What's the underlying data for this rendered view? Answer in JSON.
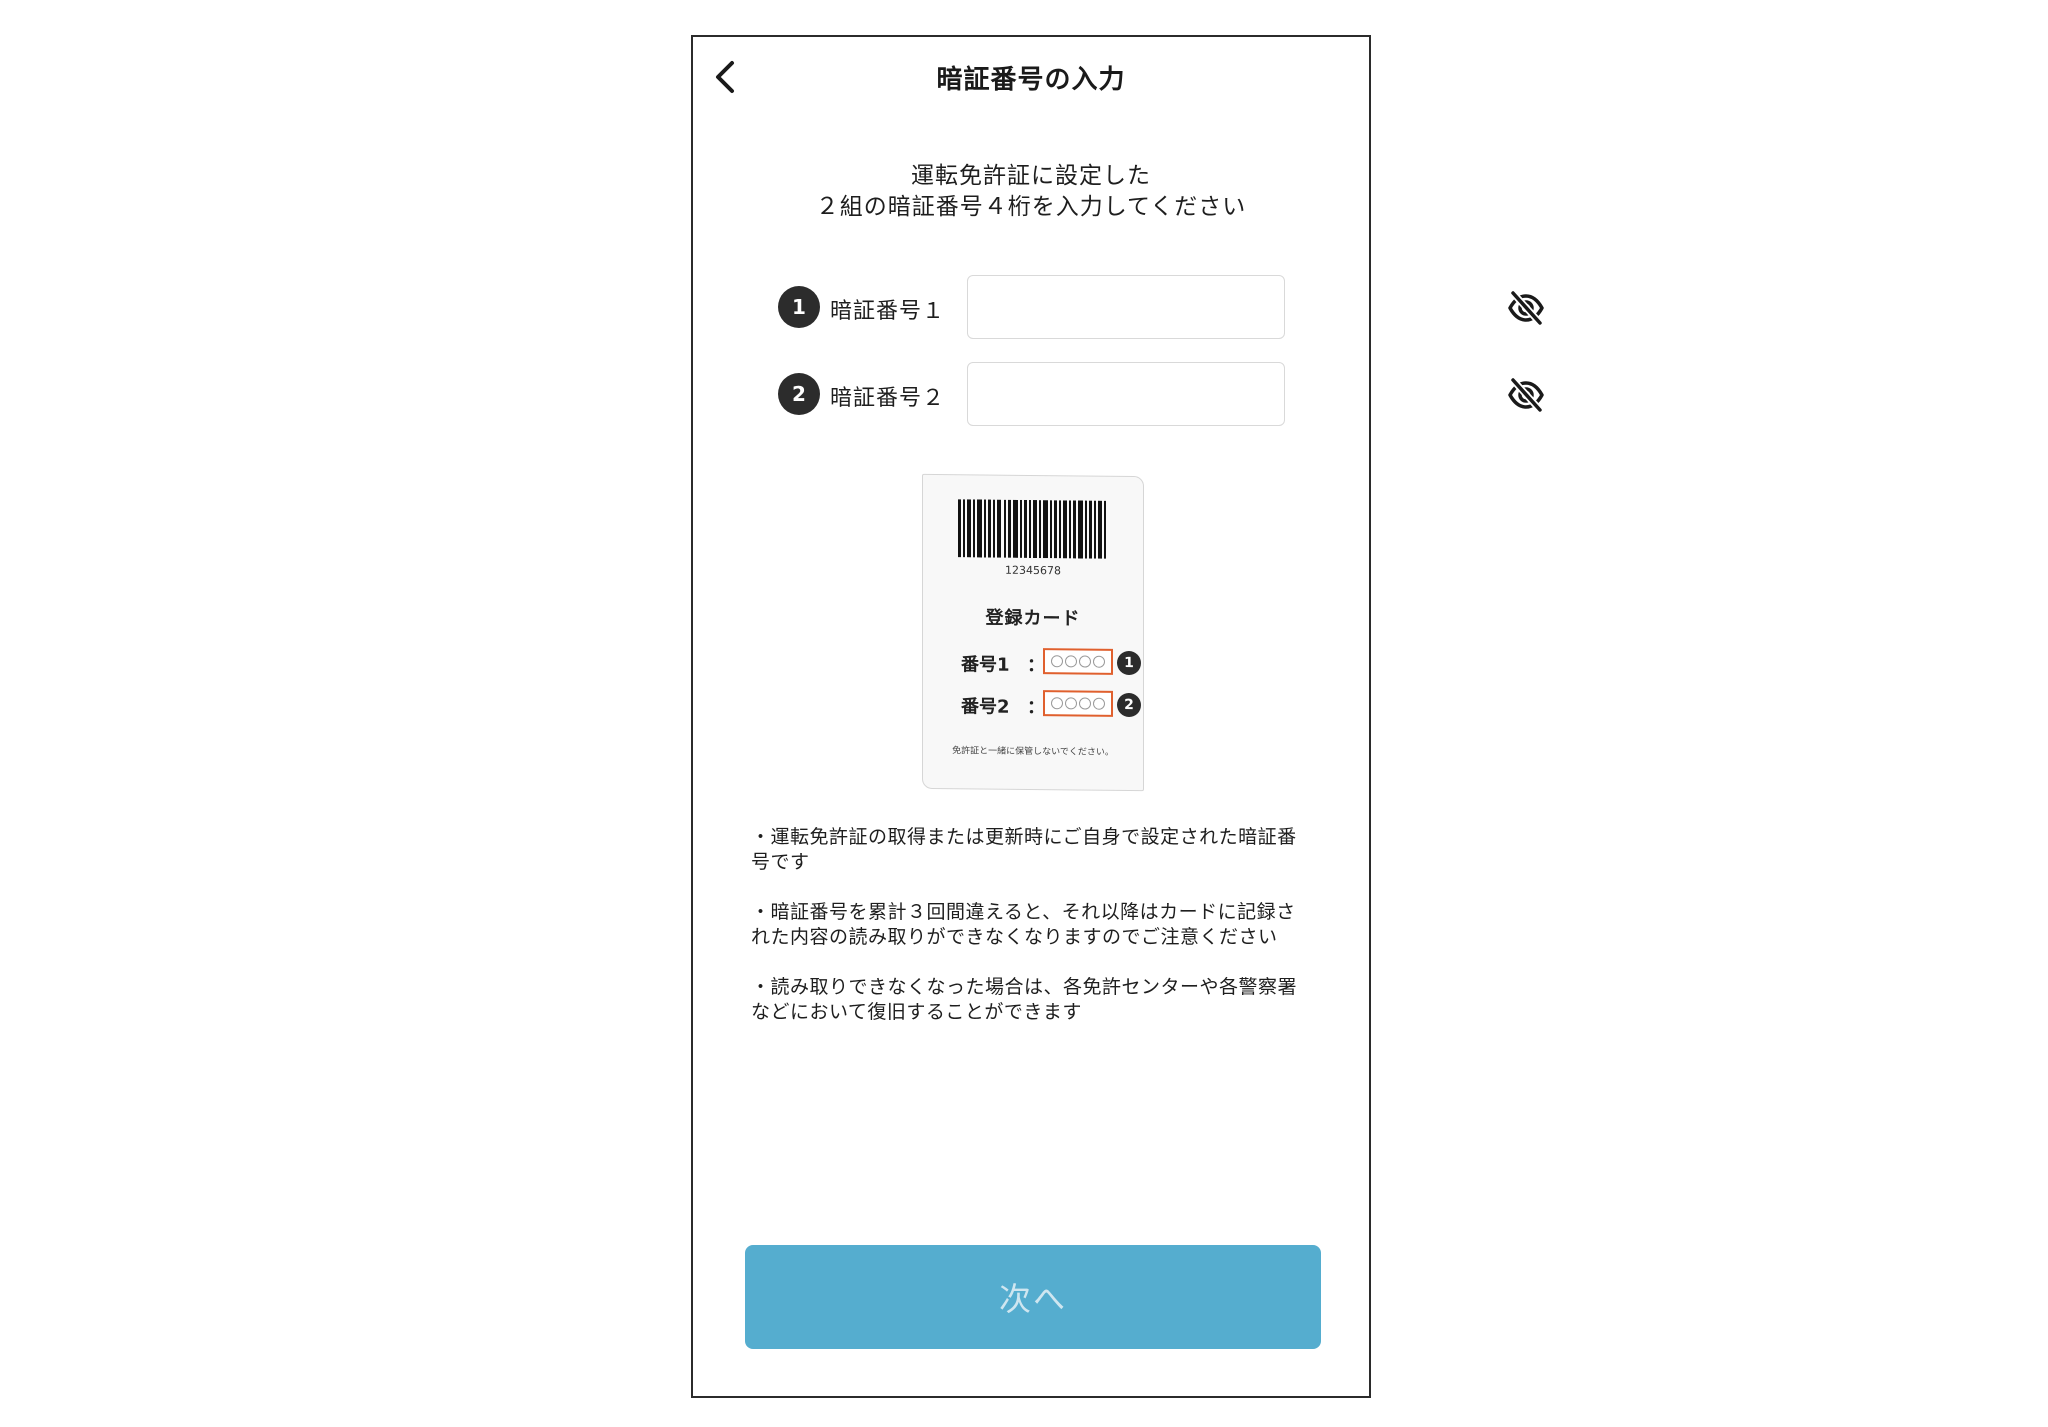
{
  "header": {
    "title": "暗証番号の入力"
  },
  "instruction": {
    "line1": "運転免許証に設定した",
    "line2": "２組の暗証番号４桁を入力してください"
  },
  "pins": [
    {
      "badge": "1",
      "label": "暗証番号１",
      "value": ""
    },
    {
      "badge": "2",
      "label": "暗証番号２",
      "value": ""
    }
  ],
  "card": {
    "barcode_number": "12345678",
    "title": "登録カード",
    "rows": [
      {
        "label": "番号1",
        "colon": "：",
        "badge": "1"
      },
      {
        "label": "番号2",
        "colon": "：",
        "badge": "2"
      }
    ],
    "note": "免許証と一緒に保管しないでください。",
    "highlight_color": "#e0602e"
  },
  "notes": {
    "note1_line1": "・運転免許証の取得または更新時にご自身で設定された暗証番",
    "note1_line2": "号です",
    "note2_line1": "・暗証番号を累計３回間違えると、それ以降はカードに記録さ",
    "note2_line2": "れた内容の読み取りができなくなりますのでご注意ください",
    "note3_line1": "・読み取りできなくなった場合は、各免許センターや各警察署",
    "note3_line2": "などにおいて復旧することができます"
  },
  "next_button": {
    "label": "次へ",
    "color": "#55adcf"
  },
  "icons": {
    "back": "chevron-left-icon",
    "visibility": "eye-off-icon"
  }
}
